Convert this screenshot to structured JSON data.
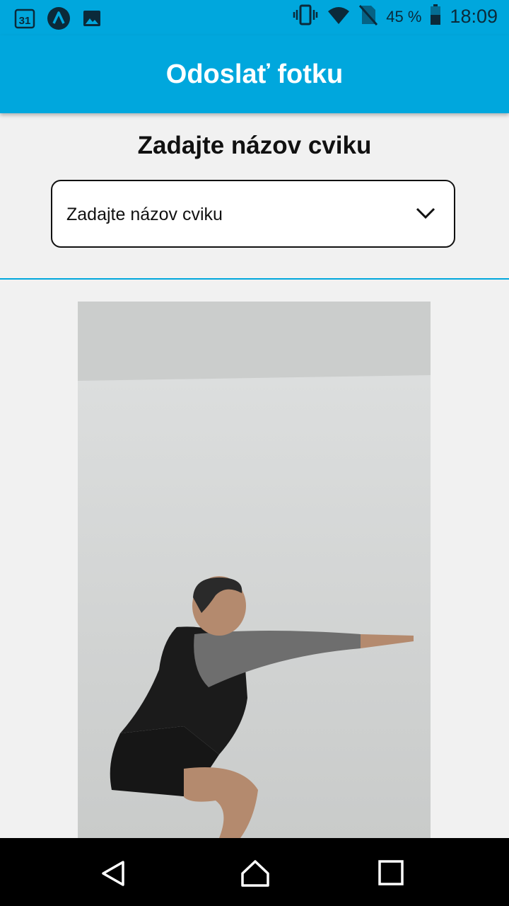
{
  "status_bar": {
    "left_icons": [
      "calendar-icon",
      "app-icon",
      "gallery-icon"
    ],
    "calendar_day": "31",
    "right_icons": [
      "vibrate-icon",
      "wifi-icon",
      "no-sim-icon",
      "battery-icon"
    ],
    "battery": "45 %",
    "time": "18:09"
  },
  "appbar": {
    "title": "Odoslať fotku"
  },
  "main": {
    "section_title": "Zadajte názov cviku",
    "exercise_select": {
      "placeholder": "Zadajte názov cviku"
    },
    "photo": {
      "description_icon": "person-squat-photo"
    }
  },
  "nav_bar": {
    "buttons": [
      "back-icon",
      "home-icon",
      "recents-icon"
    ]
  },
  "colors": {
    "accent": "#00a7dd",
    "background": "#f1f1f1",
    "nav": "#000000"
  }
}
